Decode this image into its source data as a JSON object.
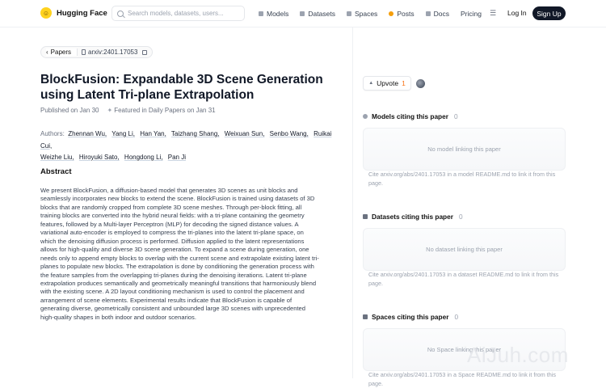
{
  "nav": {
    "brand": "Hugging Face",
    "search_placeholder": "Search models, datasets, users...",
    "links": [
      "Models",
      "Datasets",
      "Spaces",
      "Posts",
      "Docs",
      "Pricing"
    ],
    "login": "Log In",
    "signup": "Sign Up"
  },
  "breadcrumb": {
    "papers": "Papers",
    "arxiv": "arxiv:2401.17053"
  },
  "paper": {
    "title": "BlockFusion: Expandable 3D Scene Generation using Latent Tri-plane Extrapolation",
    "published": "Published on Jan 30",
    "featured_prefix": "Featured in ",
    "featured_link": "Daily Papers",
    "featured_suffix": " on Jan 31",
    "authors_label": "Authors:",
    "authors": [
      "Zhennan Wu,",
      "Yang Li,",
      "Han Yan,",
      "Taizhang Shang,",
      "Weixuan Sun,",
      "Senbo Wang,",
      "Ruikai Cui,",
      "Weizhe Liu,",
      "Hiroyuki Sato,",
      "Hongdong Li,",
      "Pan Ji"
    ],
    "abstract_heading": "Abstract",
    "abstract": "We present BlockFusion, a diffusion-based model that generates 3D scenes as unit blocks and seamlessly incorporates new blocks to extend the scene. BlockFusion is trained using datasets of 3D blocks that are randomly cropped from complete 3D scene meshes. Through per-block fitting, all training blocks are converted into the hybrid neural fields: with a tri-plane containing the geometry features, followed by a Multi-layer Perceptron (MLP) for decoding the signed distance values. A variational auto-encoder is employed to compress the tri-planes into the latent tri-plane space, on which the denoising diffusion process is performed. Diffusion applied to the latent representations allows for high-quality and diverse 3D scene generation. To expand a scene during generation, one needs only to append empty blocks to overlap with the current scene and extrapolate existing latent tri-planes to populate new blocks. The extrapolation is done by conditioning the generation process with the feature samples from the overlapping tri-planes during the denoising iterations. Latent tri-plane extrapolation produces semantically and geometrically meaningful transitions that harmoniously blend with the existing scene. A 2D layout conditioning mechanism is used to control the placement and arrangement of scene elements. Experimental results indicate that BlockFusion is capable of generating diverse, geometrically consistent and unbounded large 3D scenes with unprecedented high-quality shapes in both indoor and outdoor scenarios."
  },
  "sidebar": {
    "upvote_label": "Upvote",
    "upvote_count": "1",
    "models": {
      "title": "Models citing this paper",
      "count": "0",
      "empty": "No model linking this paper",
      "cite": "Cite arxiv.org/abs/2401.17053 in a model README.md to link it from this page."
    },
    "datasets": {
      "title": "Datasets citing this paper",
      "count": "0",
      "empty": "No dataset linking this paper",
      "cite": "Cite arxiv.org/abs/2401.17053 in a dataset README.md to link it from this page."
    },
    "spaces": {
      "title": "Spaces citing this paper",
      "count": "0",
      "empty": "No Space linking this paper",
      "cite": "Cite arxiv.org/abs/2401.17053 in a Space README.md to link it from this page."
    }
  },
  "watermark": "AiJuh.com"
}
